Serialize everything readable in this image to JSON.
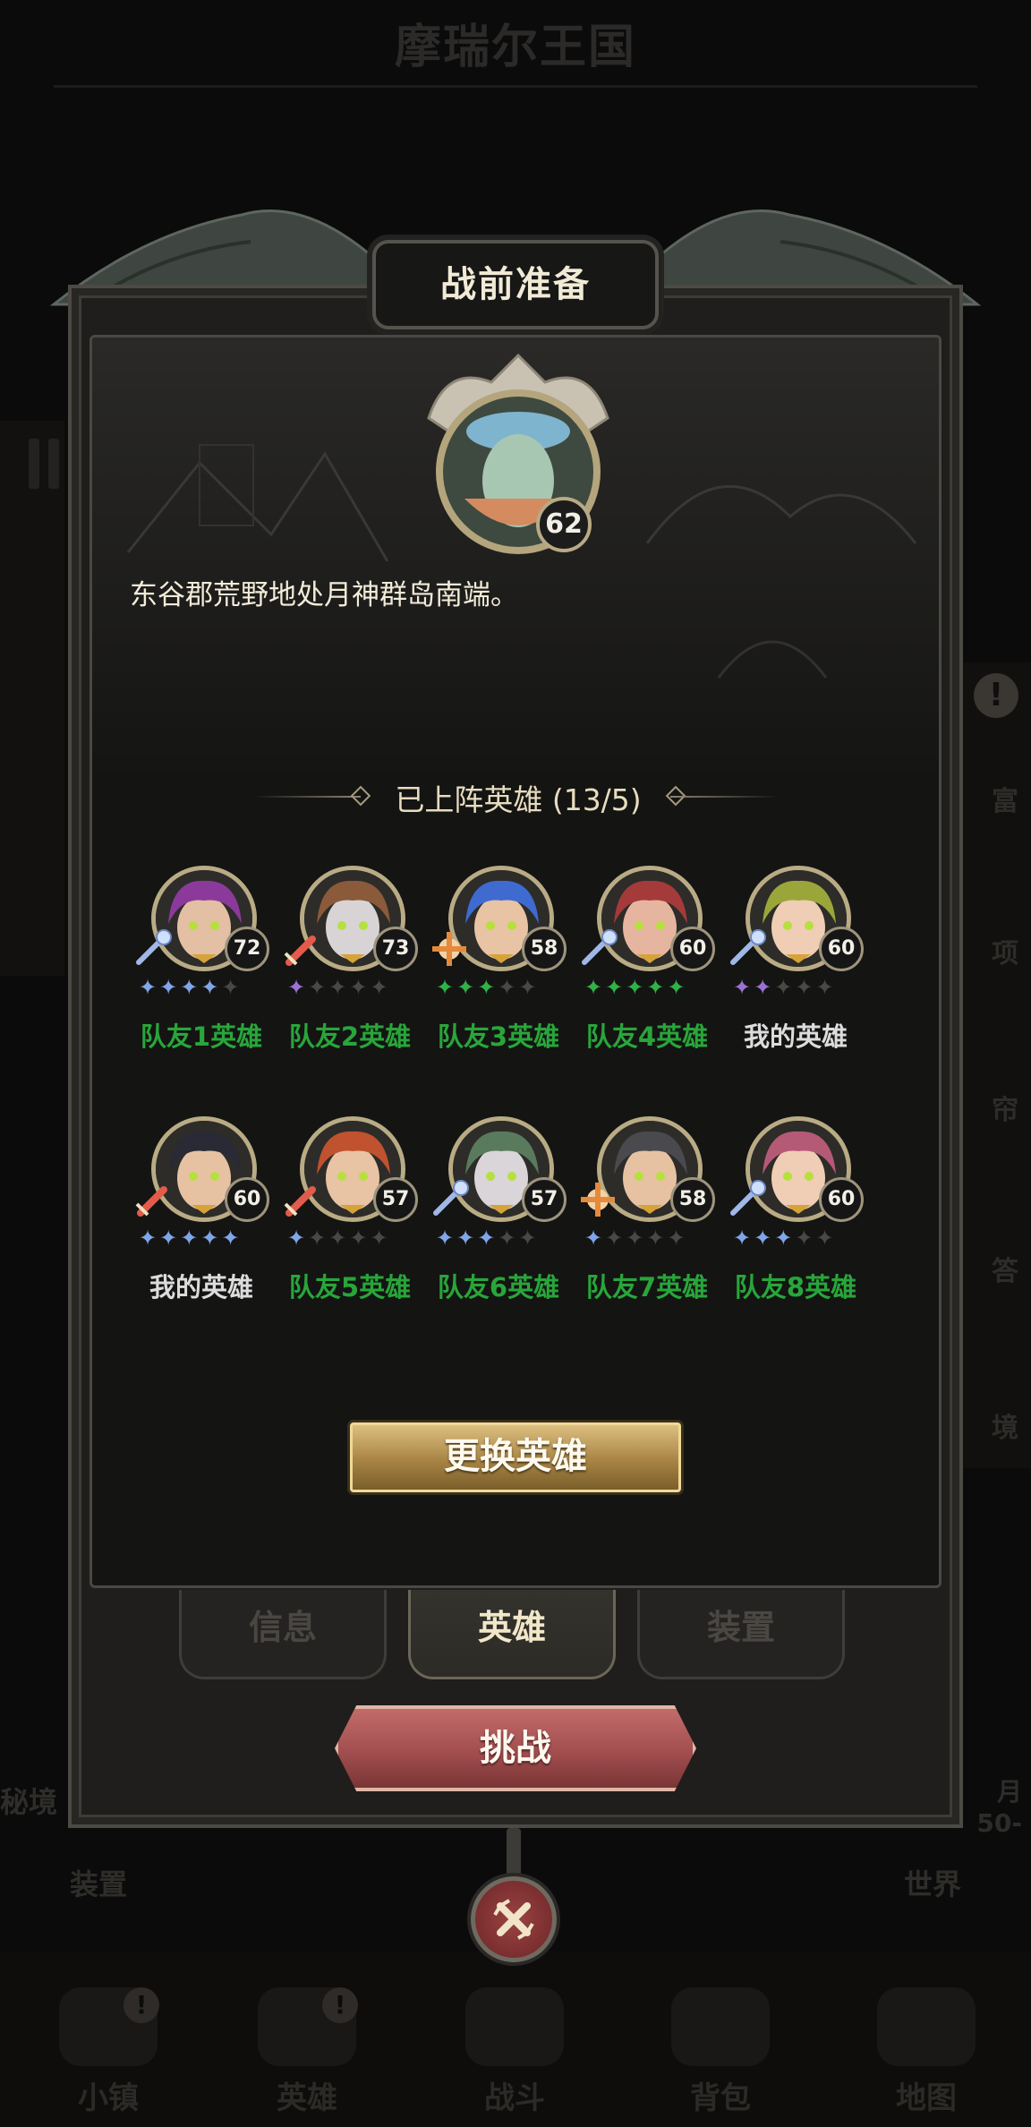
{
  "background": {
    "title": "摩瑞尔王国",
    "left_labels": [
      "秘境",
      "装置"
    ],
    "right_labels": [
      "富",
      "项",
      "帘",
      "答",
      "境"
    ],
    "right_texts": [
      "月",
      "50-"
    ],
    "world_label": "世界",
    "alert_mark": "!",
    "nav": [
      {
        "label": "小镇",
        "badge": "!"
      },
      {
        "label": "英雄",
        "badge": "!"
      },
      {
        "label": "战斗",
        "badge": ""
      },
      {
        "label": "背包",
        "badge": ""
      },
      {
        "label": "地图",
        "badge": ""
      }
    ]
  },
  "modal": {
    "title": "战前准备",
    "boss_level": "62",
    "description": "东谷郡荒野地处月神群岛南端。",
    "section_title": "已上阵英雄 (13/5)",
    "heroes": [
      {
        "name": "队友1英雄",
        "level": "72",
        "class_icon": "staff-icon",
        "stars": 4,
        "star_color": "#7fa6e8",
        "name_color": "#28a63a",
        "hair": "#8b3a9c",
        "skin": "#e3bfa3"
      },
      {
        "name": "队友2英雄",
        "level": "73",
        "class_icon": "sword-icon",
        "stars": 1,
        "star_color": "#9a72d6",
        "name_color": "#28a63a",
        "hair": "#8a5a3a",
        "skin": "#d8d4d6"
      },
      {
        "name": "队友3英雄",
        "level": "58",
        "class_icon": "cross-icon",
        "stars": 3,
        "star_color": "#2fb248",
        "name_color": "#28a63a",
        "hair": "#3f6bd0",
        "skin": "#e8c3a4"
      },
      {
        "name": "队友4英雄",
        "level": "60",
        "class_icon": "staff-icon",
        "stars": 5,
        "star_color": "#2fb248",
        "name_color": "#28a63a",
        "hair": "#a53a3a",
        "skin": "#e6b5a0"
      },
      {
        "name": "我的英雄",
        "level": "60",
        "class_icon": "staff-icon",
        "stars": 2,
        "star_color": "#9a72d6",
        "name_color": "#dcdcdc",
        "hair": "#9aa63a",
        "skin": "#f0cdb5"
      },
      {
        "name": "我的英雄",
        "level": "60",
        "class_icon": "sword-icon",
        "stars": 5,
        "star_color": "#7fa6e8",
        "name_color": "#dcdcdc",
        "hair": "#2a2a36",
        "skin": "#e6c2a3"
      },
      {
        "name": "队友5英雄",
        "level": "57",
        "class_icon": "sword-icon",
        "stars": 1,
        "star_color": "#7fa6e8",
        "name_color": "#28a63a",
        "hair": "#c0522f",
        "skin": "#e8c3a4"
      },
      {
        "name": "队友6英雄",
        "level": "57",
        "class_icon": "staff-icon",
        "stars": 3,
        "star_color": "#7fa6e8",
        "name_color": "#28a63a",
        "hair": "#5a7a5e",
        "skin": "#d9d5d8"
      },
      {
        "name": "队友7英雄",
        "level": "58",
        "class_icon": "cross-icon",
        "stars": 1,
        "star_color": "#7fa6e8",
        "name_color": "#28a63a",
        "hair": "#4a4a4e",
        "skin": "#e6c2a3"
      },
      {
        "name": "队友8英雄",
        "level": "60",
        "class_icon": "staff-icon",
        "stars": 3,
        "star_color": "#7fa6e8",
        "name_color": "#28a63a",
        "hair": "#b55a76",
        "skin": "#f0cdb5"
      }
    ],
    "switch_button": "更换英雄",
    "tabs": [
      {
        "label": "信息",
        "active": false
      },
      {
        "label": "英雄",
        "active": true
      },
      {
        "label": "装置",
        "active": false
      }
    ],
    "challenge_button": "挑战",
    "close_icon": "close-icon"
  }
}
